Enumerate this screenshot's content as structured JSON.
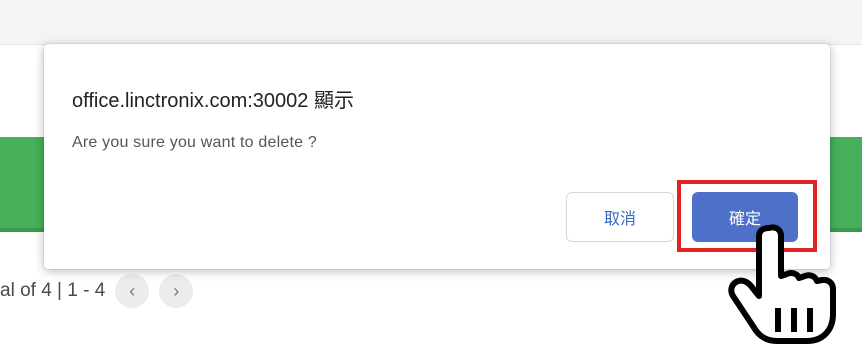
{
  "dialog": {
    "title": "office.linctronix.com:30002 顯示",
    "message": "Are you sure you want to delete ?",
    "cancel_label": "取消",
    "ok_label": "確定"
  },
  "pagination": {
    "summary": "al of 4 | 1 - 4",
    "prev_icon": "‹",
    "next_icon": "›"
  },
  "colors": {
    "primary_button": "#4f70c9",
    "highlight": "#e02424",
    "band": "#46b05a"
  },
  "icons": [
    "chevron-left-icon",
    "chevron-right-icon",
    "hand-pointer-icon"
  ]
}
